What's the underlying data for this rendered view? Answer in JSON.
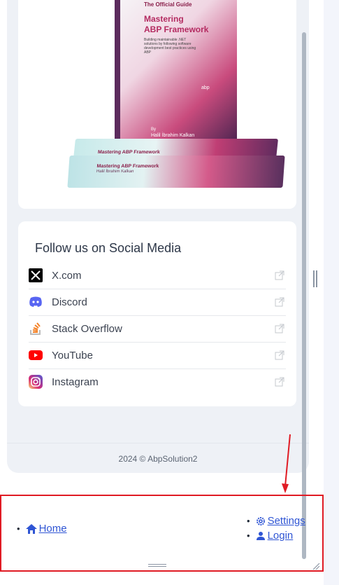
{
  "book": {
    "badge": "The Official Guide",
    "title_line1": "Mastering",
    "title_line2": "ABP Framework",
    "subtitle": "Building maintainable .NET solutions by following software development best practices using ABP",
    "brand": "abp",
    "author_by": "By",
    "author": "Halil İbrahim Kalkan",
    "stack_title": "Mastering ABP Framework",
    "stack_author": "Halil İbrahim Kalkan"
  },
  "social": {
    "title": "Follow us on Social Media",
    "items": [
      {
        "label": "X.com",
        "icon": "x-icon"
      },
      {
        "label": "Discord",
        "icon": "discord-icon"
      },
      {
        "label": "Stack Overflow",
        "icon": "stackoverflow-icon"
      },
      {
        "label": "YouTube",
        "icon": "youtube-icon"
      },
      {
        "label": "Instagram",
        "icon": "instagram-icon"
      }
    ]
  },
  "footer": {
    "copyright": "2024 © AbpSolution2"
  },
  "nav": {
    "home": "Home",
    "settings": "Settings",
    "login": "Login"
  },
  "colors": {
    "link": "#2f55d4",
    "highlight": "#e01b24"
  }
}
